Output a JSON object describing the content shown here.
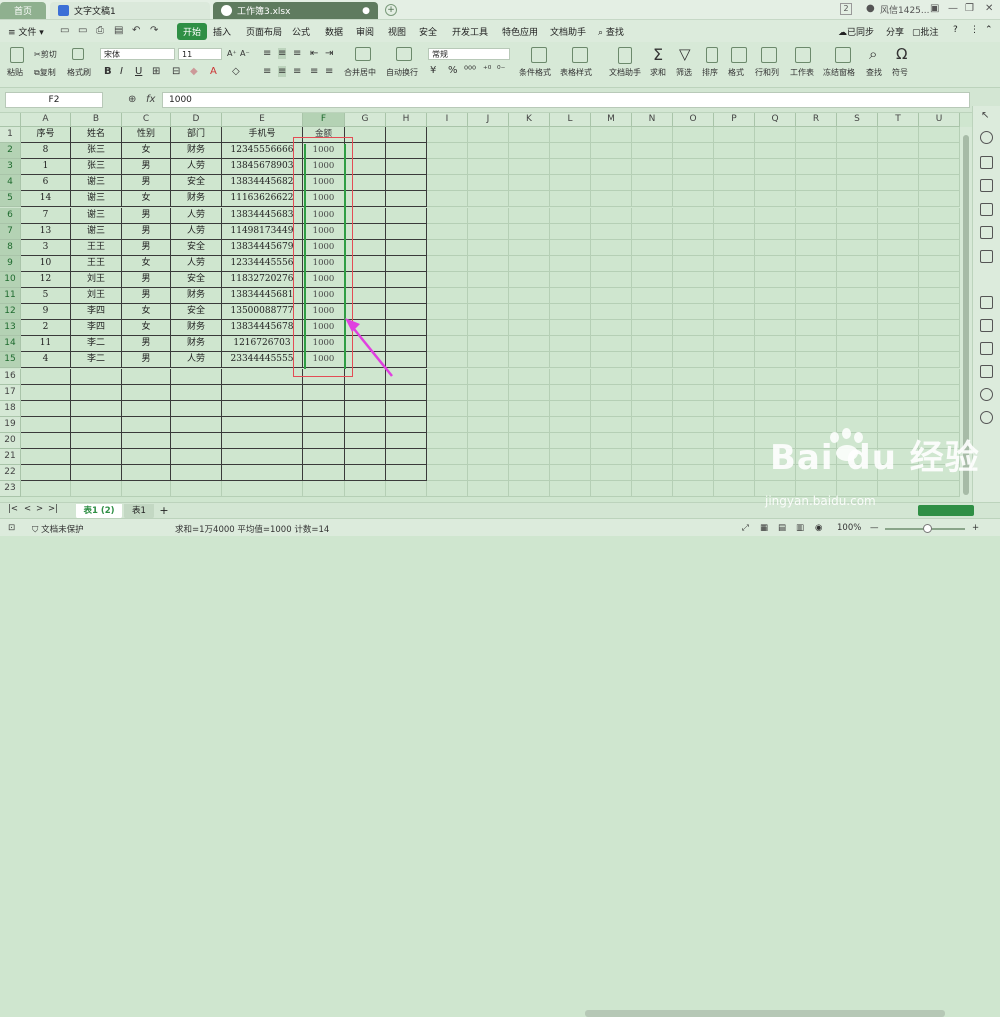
{
  "tabs": {
    "home": "首页",
    "doc": "文字文稿1",
    "sheet": "工作簿3.xlsx"
  },
  "menu": {
    "file": "文件",
    "items": [
      "开始",
      "插入",
      "页面布局",
      "公式",
      "数据",
      "审阅",
      "视图",
      "安全",
      "开发工具",
      "特色应用",
      "文档助手"
    ],
    "search": "查找",
    "sync": "已同步",
    "share": "分享",
    "annotate": "批注",
    "user": "风信1425...",
    "badge": "2"
  },
  "ribbon": {
    "paste": "粘贴",
    "cut": "剪切",
    "copy": "复制",
    "format_painter": "格式刷",
    "font_name": "宋体",
    "font_size": "11",
    "merge_center": "合并居中",
    "wrap": "自动换行",
    "number_format": "常规",
    "cond_format": "条件格式",
    "table_style": "表格样式",
    "doc_helper": "文档助手",
    "sum": "求和",
    "filter": "筛选",
    "sort": "排序",
    "format": "格式",
    "row_col": "行和列",
    "sheet": "工作表",
    "freeze": "冻结窗格",
    "find": "查找",
    "symbol": "符号",
    "bold": "B",
    "italic": "I",
    "underline": "U"
  },
  "formula_bar": {
    "name_box": "F2",
    "fx": "fx",
    "value": "1000"
  },
  "columns": [
    "A",
    "B",
    "C",
    "D",
    "E",
    "F",
    "G",
    "H",
    "I",
    "J",
    "K",
    "L",
    "M",
    "N",
    "O",
    "P",
    "Q",
    "R",
    "S",
    "T",
    "U"
  ],
  "headers": [
    "序号",
    "姓名",
    "性别",
    "部门",
    "手机号",
    "金额"
  ],
  "rows": [
    [
      "8",
      "张三",
      "女",
      "财务",
      "12345556666",
      "1000"
    ],
    [
      "1",
      "张三",
      "男",
      "人劳",
      "13845678903",
      "1000"
    ],
    [
      "6",
      "谢三",
      "男",
      "安全",
      "13834445682",
      "1000"
    ],
    [
      "14",
      "谢三",
      "女",
      "财务",
      "11163626622",
      "1000"
    ],
    [
      "7",
      "谢三",
      "男",
      "人劳",
      "13834445683",
      "1000"
    ],
    [
      "13",
      "谢三",
      "男",
      "人劳",
      "11498173449",
      "1000"
    ],
    [
      "3",
      "王王",
      "男",
      "安全",
      "13834445679",
      "1000"
    ],
    [
      "10",
      "王王",
      "女",
      "人劳",
      "12334445556",
      "1000"
    ],
    [
      "12",
      "刘王",
      "男",
      "安全",
      "11832720276",
      "1000"
    ],
    [
      "5",
      "刘王",
      "男",
      "财务",
      "13834445681",
      "1000"
    ],
    [
      "9",
      "李四",
      "女",
      "安全",
      "13500088777",
      "1000"
    ],
    [
      "2",
      "李四",
      "女",
      "财务",
      "13834445678",
      "1000"
    ],
    [
      "11",
      "李二",
      "男",
      "财务",
      "1216726703",
      "1000"
    ],
    [
      "4",
      "李二",
      "男",
      "人劳",
      "23344445555",
      "1000"
    ]
  ],
  "row_numbers": [
    "1",
    "2",
    "3",
    "4",
    "5",
    "6",
    "7",
    "8",
    "9",
    "10",
    "11",
    "12",
    "13",
    "14",
    "15",
    "16",
    "17",
    "18",
    "19",
    "20",
    "21",
    "22",
    "23"
  ],
  "sheets": {
    "active": "表1 (2)",
    "other": "表1",
    "add": "+"
  },
  "status": {
    "protect": "文档未保护",
    "stats": "求和=1万4000  平均值=1000  计数=14",
    "zoom": "100%"
  },
  "watermark": {
    "brand": "Bai du 经验",
    "url": "jingyan.baidu.com"
  },
  "colors": {
    "accent": "#2f8f45",
    "highlight_box": "#e34c55",
    "arrow": "#e040e0"
  }
}
